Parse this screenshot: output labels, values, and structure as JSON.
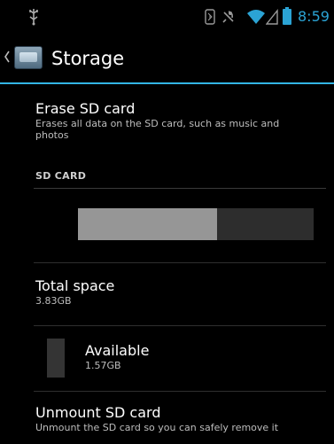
{
  "status_bar": {
    "time": "8:59",
    "icons": [
      "usb-icon",
      "bluetooth-icon",
      "mute-icon",
      "wifi-icon",
      "signal-icon",
      "battery-icon"
    ],
    "accent_color": "#33b5e5"
  },
  "action_bar": {
    "title": "Storage",
    "icon": "storage-app-icon"
  },
  "erase": {
    "title": "Erase SD card",
    "summary": "Erases all data on the SD card, such as music and photos"
  },
  "section": {
    "header": "SD CARD"
  },
  "usage": {
    "used_fraction": 0.59
  },
  "total": {
    "title": "Total space",
    "value": "3.83GB"
  },
  "available": {
    "title": "Available",
    "value": "1.57GB"
  },
  "unmount": {
    "title": "Unmount SD card",
    "summary": "Unmount the SD card so you can safely remove it"
  }
}
